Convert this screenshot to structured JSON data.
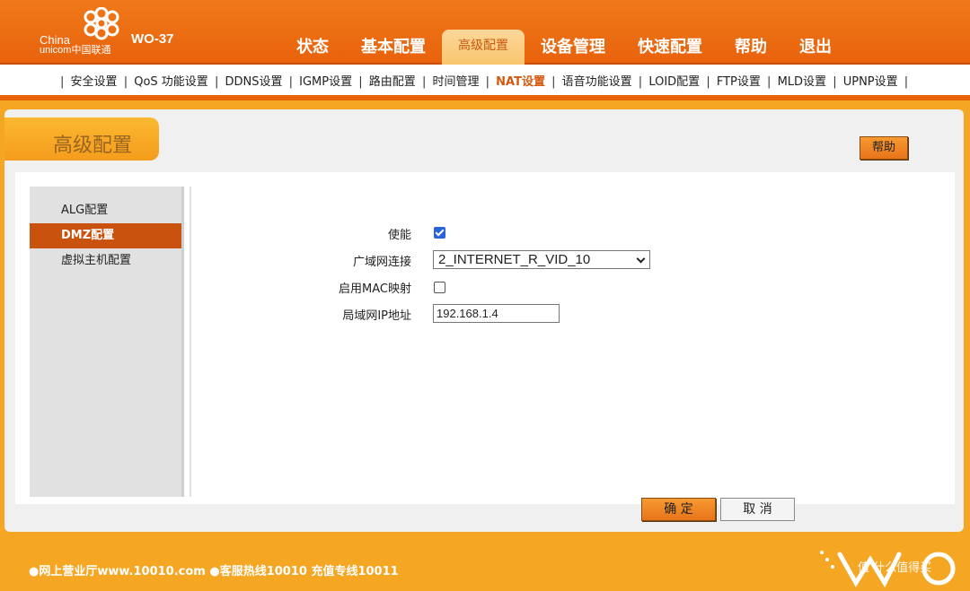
{
  "header": {
    "logo_text_line1": "China",
    "logo_text_line2": "unicom中国联通",
    "model": "WO-37",
    "tabs": [
      {
        "label": "状态"
      },
      {
        "label": "基本配置"
      },
      {
        "label": "高级配置",
        "active": true
      },
      {
        "label": "设备管理"
      },
      {
        "label": "快速配置"
      },
      {
        "label": "帮助"
      },
      {
        "label": "退出"
      }
    ],
    "colors": {
      "accent": "#e8620c",
      "active_tab": "#f9c66e"
    }
  },
  "subnav": {
    "items": [
      {
        "label": "安全设置"
      },
      {
        "label": "QoS 功能设置"
      },
      {
        "label": "DDNS设置"
      },
      {
        "label": "IGMP设置"
      },
      {
        "label": "路由配置"
      },
      {
        "label": "时间管理"
      },
      {
        "label": "NAT设置",
        "active": true
      },
      {
        "label": "语音功能设置"
      },
      {
        "label": "LOID配置"
      },
      {
        "label": "FTP设置"
      },
      {
        "label": "MLD设置"
      },
      {
        "label": "UPNP设置"
      }
    ],
    "separator": "|"
  },
  "section": {
    "title": "高级配置",
    "help_label": "帮助"
  },
  "sidenav": {
    "items": [
      {
        "label": "ALG配置"
      },
      {
        "label": "DMZ配置",
        "active": true
      },
      {
        "label": "虚拟主机配置"
      }
    ]
  },
  "form": {
    "enable_label": "使能",
    "enable_checked": true,
    "wan_label": "广域网连接",
    "wan_value": "2_INTERNET_R_VID_10",
    "mac_label": "启用MAC映射",
    "mac_checked": false,
    "lan_ip_label": "局域网IP地址",
    "lan_ip_value": "192.168.1.4"
  },
  "actions": {
    "ok_label": "确 定",
    "cancel_label": "取 消"
  },
  "footer": {
    "text": "●网上营业厅www.10010.com ●客服热线10010 充值专线10011",
    "watermark": "值 什么值得买"
  }
}
